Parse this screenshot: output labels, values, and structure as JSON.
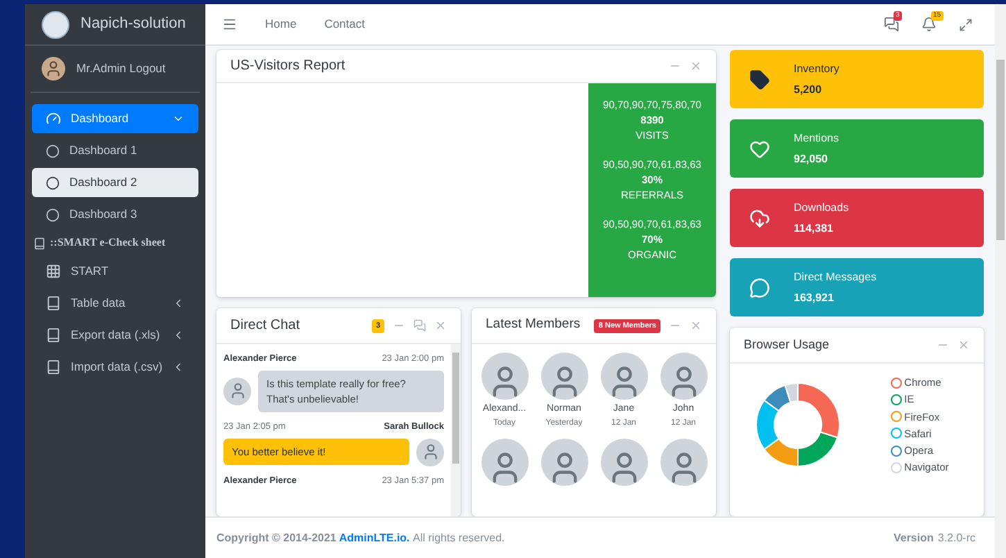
{
  "brand": {
    "name": "Napich-solution"
  },
  "user": {
    "label": "Mr.Admin Logout"
  },
  "sidebar": {
    "items": [
      {
        "kind": "dashboard",
        "label": "Dashboard",
        "selected": true,
        "expanded": true,
        "children": [
          {
            "label": "Dashboard 1",
            "selected": false
          },
          {
            "label": "Dashboard 2",
            "selected": true
          },
          {
            "label": "Dashboard 3",
            "selected": false
          }
        ]
      },
      {
        "kind": "header",
        "label": "::SMART e-Check sheet"
      },
      {
        "kind": "grid",
        "label": "START",
        "selected": false
      },
      {
        "kind": "book",
        "label": "Table data",
        "selected": false,
        "expanded": false
      },
      {
        "kind": "book",
        "label": "Export data (.xls)",
        "selected": false,
        "expanded": false
      },
      {
        "kind": "book",
        "label": "Import data (.csv)",
        "selected": false,
        "expanded": false
      }
    ]
  },
  "navbar": {
    "links": [
      "Home",
      "Contact"
    ],
    "messages_badge": "3",
    "notifications_badge": "15"
  },
  "visitors_report": {
    "title": "US-Visitors Report",
    "stats": [
      {
        "sparkline": "90,70,90,70,75,80,70",
        "value": "8390",
        "label": "VISITS"
      },
      {
        "sparkline": "90,50,90,70,61,83,63",
        "value": "30%",
        "label": "REFERRALS"
      },
      {
        "sparkline": "90,50,90,70,61,83,63",
        "value": "70%",
        "label": "ORGANIC"
      }
    ]
  },
  "info_boxes": [
    {
      "kind": "tag",
      "label": "Inventory",
      "value": "5,200",
      "color": "#ffc107"
    },
    {
      "kind": "heart",
      "label": "Mentions",
      "value": "92,050",
      "color": "#28a745"
    },
    {
      "kind": "download",
      "label": "Downloads",
      "value": "114,381",
      "color": "#dc3545"
    },
    {
      "kind": "message",
      "label": "Direct Messages",
      "value": "163,921",
      "color": "#17a2b8"
    }
  ],
  "direct_chat": {
    "title": "Direct Chat",
    "badge": "3",
    "messages": [
      {
        "kind": "received",
        "name": "Alexander Pierce",
        "time": "23 Jan 2:00 pm",
        "text": "Is this template really for free? That's unbelievable!"
      },
      {
        "kind": "sent",
        "name": "Sarah Bullock",
        "time": "23 Jan 2:05 pm",
        "text": "You better believe it!"
      },
      {
        "kind": "received",
        "name": "Alexander Pierce",
        "time": "23 Jan 5:37 pm"
      }
    ]
  },
  "latest_members": {
    "title": "Latest Members",
    "badge": "8 New Members",
    "members": [
      {
        "kind": "named",
        "name": "Alexand...",
        "date": "Today"
      },
      {
        "kind": "named",
        "name": "Norman",
        "date": "Yesterday"
      },
      {
        "kind": "named",
        "name": "Jane",
        "date": "12 Jan"
      },
      {
        "kind": "named",
        "name": "John",
        "date": "12 Jan"
      },
      {
        "kind": "photo"
      },
      {
        "kind": "photo"
      },
      {
        "kind": "photo"
      },
      {
        "kind": "photo"
      }
    ]
  },
  "browser_usage": {
    "title": "Browser Usage",
    "legend": [
      {
        "label": "Chrome",
        "color": "#f56954"
      },
      {
        "label": "IE",
        "color": "#00a65a"
      },
      {
        "label": "FireFox",
        "color": "#f39c12"
      },
      {
        "label": "Safari",
        "color": "#00c0ef"
      },
      {
        "label": "Opera",
        "color": "#3c8dbc"
      },
      {
        "label": "Navigator",
        "color": "#d2d6de"
      }
    ]
  },
  "footer": {
    "link": "AdminLTE.io.",
    "rest": "All rights reserved.",
    "prefix": "Copyright © 2014-2021",
    "version_label": "Version",
    "version": "3.2.0-rc"
  }
}
